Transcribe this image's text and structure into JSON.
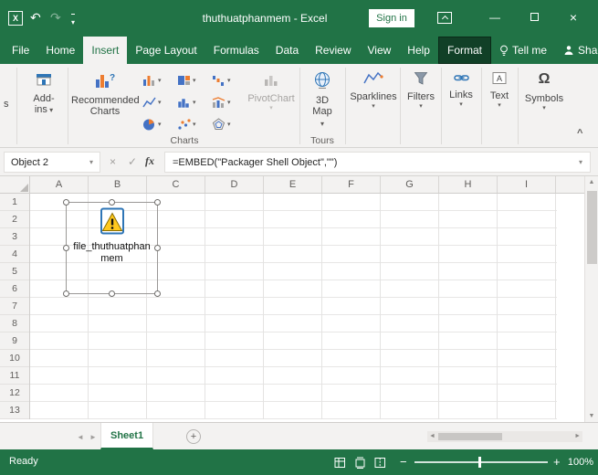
{
  "icons": {
    "app": "X",
    "undo": "↶",
    "redo": "↷",
    "qat_caret": "▾",
    "minimize": "—",
    "close": "×",
    "cancel": "×",
    "enter": "✓",
    "fx": "fx",
    "omega": "Ω",
    "collapse_ribbon": "^",
    "name_caret": "▾",
    "formula_caret": "▾",
    "scroll_up": "▲",
    "scroll_down": "▼",
    "tab_nav_left": "◄",
    "tab_nav_right": "►",
    "new_sheet": "+",
    "zoom_out": "−",
    "zoom_in": "+"
  },
  "titlebar": {
    "title": "thuthuatphanmem - Excel",
    "sign_in_label": "Sign in"
  },
  "ribbon_tabs": {
    "items": [
      {
        "label": "File"
      },
      {
        "label": "Home"
      },
      {
        "label": "Insert"
      },
      {
        "label": "Page Layout"
      },
      {
        "label": "Formulas"
      },
      {
        "label": "Data"
      },
      {
        "label": "Review"
      },
      {
        "label": "View"
      },
      {
        "label": "Help"
      },
      {
        "label": "Format"
      }
    ],
    "tell_me": "Tell me",
    "share": "Share"
  },
  "ribbon": {
    "clipped_label": "s",
    "add_ins": "Add-ins",
    "recommended_charts": "Recommended Charts",
    "pivot_chart": "PivotChart",
    "map_3d": "3D Map",
    "sparklines": "Sparklines",
    "filters": "Filters",
    "links": "Links",
    "text": "Text",
    "symbols": "Symbols",
    "group_charts": "Charts",
    "group_tours": "Tours"
  },
  "formula_bar": {
    "name_box": "Object 2",
    "formula": "=EMBED(\"Packager Shell Object\",\"\")"
  },
  "sheet": {
    "columns": [
      "A",
      "B",
      "C",
      "D",
      "E",
      "F",
      "G",
      "H",
      "I"
    ],
    "rows": [
      "1",
      "2",
      "3",
      "4",
      "5",
      "6",
      "7",
      "8",
      "9",
      "10",
      "11",
      "12",
      "13"
    ],
    "object_label_line1": "file_thuthuatphan",
    "object_label_line2": "mem"
  },
  "sheet_tabs": {
    "active": "Sheet1"
  },
  "status_bar": {
    "mode": "Ready",
    "zoom_level": "100%"
  },
  "colors": {
    "excel_green": "#217346",
    "accent_blue": "#4472c4",
    "accent_orange": "#ed7d31",
    "warning_yellow": "#ffc81e"
  }
}
